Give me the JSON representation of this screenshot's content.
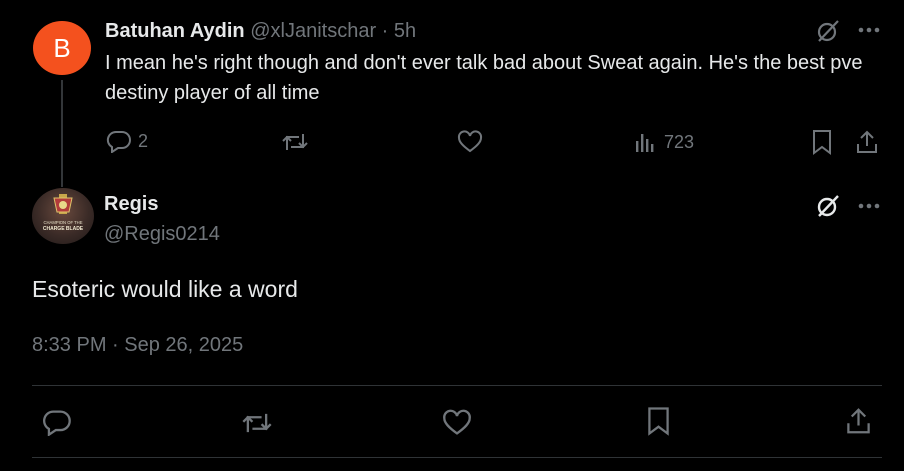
{
  "reply": {
    "avatar_letter": "B",
    "avatar_color": "#f4511e",
    "name": "Batuhan Aydin",
    "handle": "@xlJanitschar",
    "separator": "·",
    "time": "5h",
    "text": "I mean he's right though and don't ever talk bad about Sweat again. He's the best pve destiny player of all time",
    "actions": {
      "reply_count": "2",
      "views_count": "723"
    },
    "icons": [
      "grok-icon",
      "more-icon",
      "reply-icon",
      "repost-icon",
      "like-icon",
      "views-icon",
      "bookmark-icon",
      "share-icon"
    ]
  },
  "main": {
    "name": "Regis",
    "handle": "@Regis0214",
    "avatar_caption_line1": "CHAMPION OF THE",
    "avatar_caption_line2": "CHARGE BLADE",
    "text": "Esoteric would like a word",
    "timestamp": "8:33 PM · Sep 26, 2025",
    "icons": [
      "grok-icon",
      "more-icon",
      "reply-icon",
      "repost-icon",
      "like-icon",
      "bookmark-icon",
      "share-icon"
    ]
  },
  "colors": {
    "background": "#000000",
    "text": "#e7e9ea",
    "muted": "#71767b",
    "divider": "#2f3336"
  }
}
